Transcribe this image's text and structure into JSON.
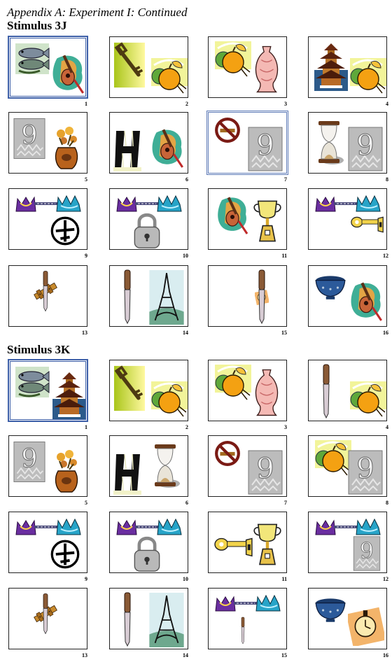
{
  "header": {
    "appendix_title": "Appendix A: Experiment I: Continued"
  },
  "stimuli": [
    {
      "title": "Stimulus 3J",
      "cards": [
        {
          "number": "1",
          "selected": true,
          "icons": [
            "fish-icon",
            "guitar-icon"
          ]
        },
        {
          "number": "2",
          "selected": false,
          "icons": [
            "key-icon",
            "orange-icon"
          ]
        },
        {
          "number": "3",
          "selected": false,
          "icons": [
            "orange-icon",
            "vase-icon"
          ]
        },
        {
          "number": "4",
          "selected": false,
          "icons": [
            "pagoda-icon",
            "orange-icon"
          ]
        },
        {
          "number": "5",
          "selected": false,
          "icons": [
            "nine-icon",
            "flower-pot-icon"
          ]
        },
        {
          "number": "6",
          "selected": false,
          "icons": [
            "letter-h-icon",
            "guitar-icon"
          ]
        },
        {
          "number": "7",
          "selected": "light",
          "icons": [
            "no-smoking-icon",
            "nine-icon"
          ]
        },
        {
          "number": "8",
          "selected": false,
          "icons": [
            "hourglass-icon",
            "nine-icon"
          ]
        },
        {
          "number": "9",
          "selected": false,
          "icons": [
            "chain-icon",
            "airplane-icon"
          ]
        },
        {
          "number": "10",
          "selected": false,
          "icons": [
            "chain-icon",
            "padlock-icon"
          ]
        },
        {
          "number": "11",
          "selected": false,
          "icons": [
            "guitar-icon",
            "trophy-icon"
          ]
        },
        {
          "number": "12",
          "selected": false,
          "icons": [
            "chain-icon",
            "windup-key-icon"
          ]
        },
        {
          "number": "13",
          "selected": false,
          "icons": [
            "latch-icon",
            "knife-icon"
          ]
        },
        {
          "number": "14",
          "selected": false,
          "icons": [
            "knife-icon",
            "eiffel-tower-icon"
          ]
        },
        {
          "number": "15",
          "selected": false,
          "icons": [
            "stopwatch-icon",
            "knife-icon"
          ]
        },
        {
          "number": "16",
          "selected": false,
          "icons": [
            "colander-icon",
            "guitar-icon"
          ]
        }
      ]
    },
    {
      "title": "Stimulus 3K",
      "cards": [
        {
          "number": "1",
          "selected": true,
          "icons": [
            "fish-icon",
            "pagoda-icon"
          ]
        },
        {
          "number": "2",
          "selected": false,
          "icons": [
            "key-icon",
            "orange-icon"
          ]
        },
        {
          "number": "3",
          "selected": false,
          "icons": [
            "orange-icon",
            "vase-icon"
          ]
        },
        {
          "number": "4",
          "selected": false,
          "icons": [
            "knife-icon",
            "orange-icon"
          ]
        },
        {
          "number": "5",
          "selected": false,
          "icons": [
            "nine-icon",
            "flower-pot-icon"
          ]
        },
        {
          "number": "6",
          "selected": false,
          "icons": [
            "letter-h-icon",
            "hourglass-icon"
          ]
        },
        {
          "number": "7",
          "selected": false,
          "icons": [
            "no-smoking-icon",
            "nine-icon"
          ]
        },
        {
          "number": "8",
          "selected": false,
          "icons": [
            "orange-icon",
            "nine-icon"
          ]
        },
        {
          "number": "9",
          "selected": false,
          "icons": [
            "chain-icon",
            "airplane-icon"
          ]
        },
        {
          "number": "10",
          "selected": false,
          "icons": [
            "chain-icon",
            "padlock-icon"
          ]
        },
        {
          "number": "11",
          "selected": false,
          "icons": [
            "windup-key-icon",
            "trophy-icon"
          ]
        },
        {
          "number": "12",
          "selected": false,
          "icons": [
            "chain-icon",
            "nine-icon"
          ]
        },
        {
          "number": "13",
          "selected": false,
          "icons": [
            "latch-icon",
            "knife-icon"
          ]
        },
        {
          "number": "14",
          "selected": false,
          "icons": [
            "knife-icon",
            "eiffel-tower-icon"
          ]
        },
        {
          "number": "15",
          "selected": false,
          "icons": [
            "chain-icon",
            "knife-icon"
          ]
        },
        {
          "number": "16",
          "selected": false,
          "icons": [
            "colander-icon",
            "stopwatch-icon"
          ]
        }
      ]
    }
  ],
  "colors": {
    "selection_border": "#3d5fa8",
    "card_border": "#222222"
  }
}
